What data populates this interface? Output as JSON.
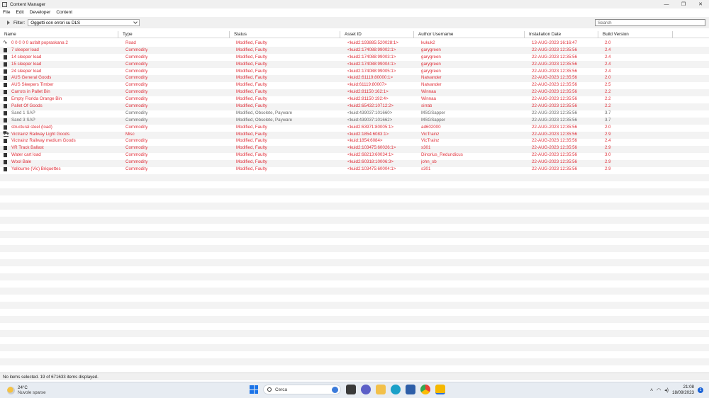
{
  "window": {
    "title": "Content Manager"
  },
  "menu": [
    "File",
    "Edit",
    "Developer",
    "Content"
  ],
  "filter": {
    "label": "Filter:",
    "value": "Oggetti con errori su DLS"
  },
  "search": {
    "placeholder": "Search"
  },
  "columns": [
    "Name",
    "Type",
    "Status",
    "Asset ID",
    "Author Username",
    "Installation Date",
    "Build Version"
  ],
  "rows": [
    {
      "icon": "road-icon",
      "name": "0 0 0 0 0 asfalt popraskana 2",
      "type": "Road",
      "status": "Modified, Faulty",
      "asset_id": "<kuid2:193885:520028:1>",
      "author": "kukuk2",
      "date": "13-AUG-2023 16:16:47",
      "build": "2.0",
      "style": "red"
    },
    {
      "icon": "commodity-icon",
      "name": "7 sleeper load",
      "type": "Commodity",
      "status": "Modified, Faulty",
      "asset_id": "<kuid2:174088:99002:1>",
      "author": "garygreen",
      "date": "22-AUG-2023 12:35:56",
      "build": "2.4",
      "style": "red"
    },
    {
      "icon": "commodity-icon",
      "name": "14 sleeper load",
      "type": "Commodity",
      "status": "Modified, Faulty",
      "asset_id": "<kuid2:174088:99003:1>",
      "author": "garygreen",
      "date": "22-AUG-2023 12:35:56",
      "build": "2.4",
      "style": "red"
    },
    {
      "icon": "commodity-icon",
      "name": "15 sleeper load",
      "type": "Commodity",
      "status": "Modified, Faulty",
      "asset_id": "<kuid2:174088:99004:1>",
      "author": "garygreen",
      "date": "22-AUG-2023 12:35:56",
      "build": "2.4",
      "style": "red"
    },
    {
      "icon": "commodity-icon",
      "name": "24 sleeper load",
      "type": "Commodity",
      "status": "Modified, Faulty",
      "asset_id": "<kuid2:174088:99005:1>",
      "author": "garygreen",
      "date": "22-AUG-2023 12:35:56",
      "build": "2.4",
      "style": "red"
    },
    {
      "icon": "commodity-icon",
      "name": "AUS General Goods",
      "type": "Commodity",
      "status": "Modified, Faulty",
      "asset_id": "<kuid2:61119:80000:1>",
      "author": "Natvander",
      "date": "22-AUG-2023 12:35:56",
      "build": "2.0",
      "style": "red"
    },
    {
      "icon": "commodity-icon",
      "name": "AUS Sleepers Timber",
      "type": "Commodity",
      "status": "Modified, Faulty",
      "asset_id": "<kuid:61119:80007>",
      "author": "Natvander",
      "date": "22-AUG-2023 12:35:56",
      "build": "2.5",
      "style": "red"
    },
    {
      "icon": "commodity-icon",
      "name": "Carrots in Pallet Bin",
      "type": "Commodity",
      "status": "Modified, Faulty",
      "asset_id": "<kuid2:81150:162:1>",
      "author": "Winnaa",
      "date": "22-AUG-2023 12:35:56",
      "build": "2.2",
      "style": "red"
    },
    {
      "icon": "commodity-icon",
      "name": "Empty Florida Orange Bin",
      "type": "Commodity",
      "status": "Modified, Faulty",
      "asset_id": "<kuid2:81150:192:4>",
      "author": "Winnaa",
      "date": "22-AUG-2023 12:35:56",
      "build": "2.2",
      "style": "red"
    },
    {
      "icon": "commodity-icon",
      "name": "Pallet Of Goods",
      "type": "Commodity",
      "status": "Modified, Faulty",
      "asset_id": "<kuid2:65432:10712:2>",
      "author": "sirrab",
      "date": "22-AUG-2023 12:35:56",
      "build": "2.2",
      "style": "red"
    },
    {
      "icon": "commodity-icon",
      "name": "Sand 1 SAP",
      "type": "Commodity",
      "status": "Modified, Obsolete, Payware",
      "asset_id": "<kuid:439037:101660>",
      "author": "MSGSapper",
      "date": "22-AUG-2023 12:35:56",
      "build": "3.7",
      "style": "gray"
    },
    {
      "icon": "commodity-icon",
      "name": "Sand 3 SAP",
      "type": "Commodity",
      "status": "Modified, Obsolete, Payware",
      "asset_id": "<kuid:439037:101662>",
      "author": "MSGSapper",
      "date": "22-AUG-2023 12:35:56",
      "build": "3.7",
      "style": "gray"
    },
    {
      "icon": "commodity-icon",
      "name": "structural steel (load)",
      "type": "Commodity",
      "status": "Modified, Faulty",
      "asset_id": "<kuid2:63971:80005:1>",
      "author": "ad602000",
      "date": "22-AUG-2023 12:35:56",
      "build": "2.0",
      "style": "red"
    },
    {
      "icon": "misc-icon",
      "name": "Victrainz Railway Light Goods",
      "type": "Misc",
      "status": "Modified, Faulty",
      "asset_id": "<kuid2:1854:6083:1>",
      "author": "VicTrainz",
      "date": "22-AUG-2023 12:35:56",
      "build": "2.9",
      "style": "red"
    },
    {
      "icon": "commodity-icon",
      "name": "Victrainz Railway medium Goods",
      "type": "Commodity",
      "status": "Modified, Faulty",
      "asset_id": "<kuid:1854:6084>",
      "author": "VicTrainz",
      "date": "22-AUG-2023 12:35:56",
      "build": "2.4",
      "style": "red"
    },
    {
      "icon": "commodity-icon",
      "name": "VR Track Ballast",
      "type": "Commodity",
      "status": "Modified, Faulty",
      "asset_id": "<kuid2:103475:60026:1>",
      "author": "s301",
      "date": "22-AUG-2023 12:35:56",
      "build": "2.9",
      "style": "red"
    },
    {
      "icon": "commodity-icon",
      "name": "Water cart load",
      "type": "Commodity",
      "status": "Modified, Faulty",
      "asset_id": "<kuid2:68213:60034:1>",
      "author": "Dinorius_Redundicus",
      "date": "22-AUG-2023 12:35:56",
      "build": "3.0",
      "style": "red"
    },
    {
      "icon": "commodity-icon",
      "name": "Wool Bale",
      "type": "Commodity",
      "status": "Modified, Faulty",
      "asset_id": "<kuid2:60318:10006:3>",
      "author": "john_sb",
      "date": "22-AUG-2023 12:35:56",
      "build": "2.9",
      "style": "red"
    },
    {
      "icon": "commodity-icon",
      "name": "Yallourne (Vic) Briquettes",
      "type": "Commodity",
      "status": "Modified, Faulty",
      "asset_id": "<kuid2:103475:60004:1>",
      "author": "s301",
      "date": "22-AUG-2023 12:35:56",
      "build": "2.9",
      "style": "red"
    }
  ],
  "status_bar": "No items selected. 19 of 671633 items displayed.",
  "taskbar": {
    "weather_temp": "24°C",
    "weather_desc": "Nuvole sparse",
    "search_label": "Cerca",
    "time": "21:08",
    "date": "18/09/2023",
    "notifications": "1"
  },
  "colors": {
    "faulty": "#e0303a",
    "obsolete": "#6a6a6a",
    "accent": "#1a73e8"
  }
}
